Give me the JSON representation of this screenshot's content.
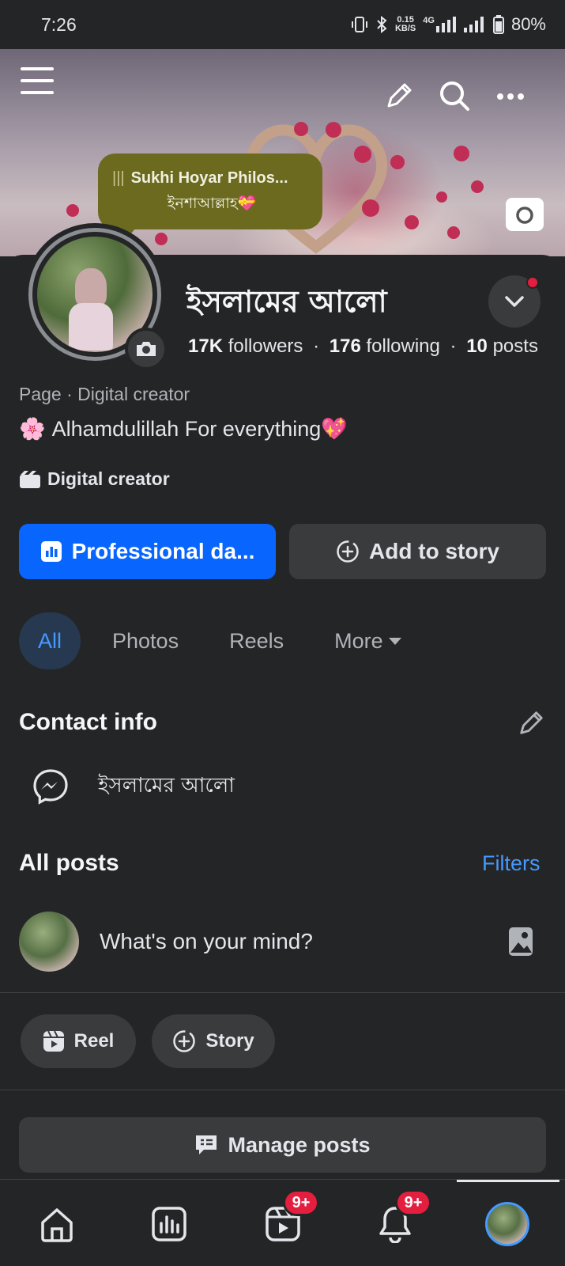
{
  "status_bar": {
    "time": "7:26",
    "net_speed_value": "0.15",
    "net_speed_unit": "KB/S",
    "network_type": "4G",
    "battery": "80%"
  },
  "cover": {
    "icons": [
      "menu-icon",
      "pencil-icon",
      "search-icon",
      "more-icon",
      "camera-icon"
    ]
  },
  "note_bubble": {
    "title": "Sukhi Hoyar Philos...",
    "text": "ইনশাআল্লাহ💝"
  },
  "profile": {
    "name": "ইসলামের আলো",
    "followers_count": "17K",
    "followers_label": "followers",
    "following_count": "176",
    "following_label": "following",
    "posts_count": "10",
    "posts_label": "posts",
    "separator": "·",
    "page_category": "Page · Digital creator",
    "bio_emoji": "🌸",
    "bio": "Alhamdulillah For everything💖",
    "category": "Digital creator"
  },
  "actions": {
    "professional": "Professional da...",
    "add_story": "Add to story"
  },
  "tabs": [
    {
      "label": "All",
      "active": true
    },
    {
      "label": "Photos",
      "active": false
    },
    {
      "label": "Reels",
      "active": false
    },
    {
      "label": "More",
      "active": false
    }
  ],
  "contact": {
    "title": "Contact info",
    "messenger_name": "ইসলামের আলো"
  },
  "posts": {
    "title": "All posts",
    "filters": "Filters",
    "composer_placeholder": "What's on your mind?",
    "reel": "Reel",
    "story": "Story",
    "manage": "Manage posts"
  },
  "bottom_nav": {
    "reels_badge": "9+",
    "notifications_badge": "9+"
  },
  "colors": {
    "background": "#242526",
    "accent_blue": "#0866ff",
    "link_blue": "#4599ff",
    "badge_red": "#e41e3f",
    "button_gray": "#3a3b3c",
    "note_olive": "#6b6a1f"
  }
}
